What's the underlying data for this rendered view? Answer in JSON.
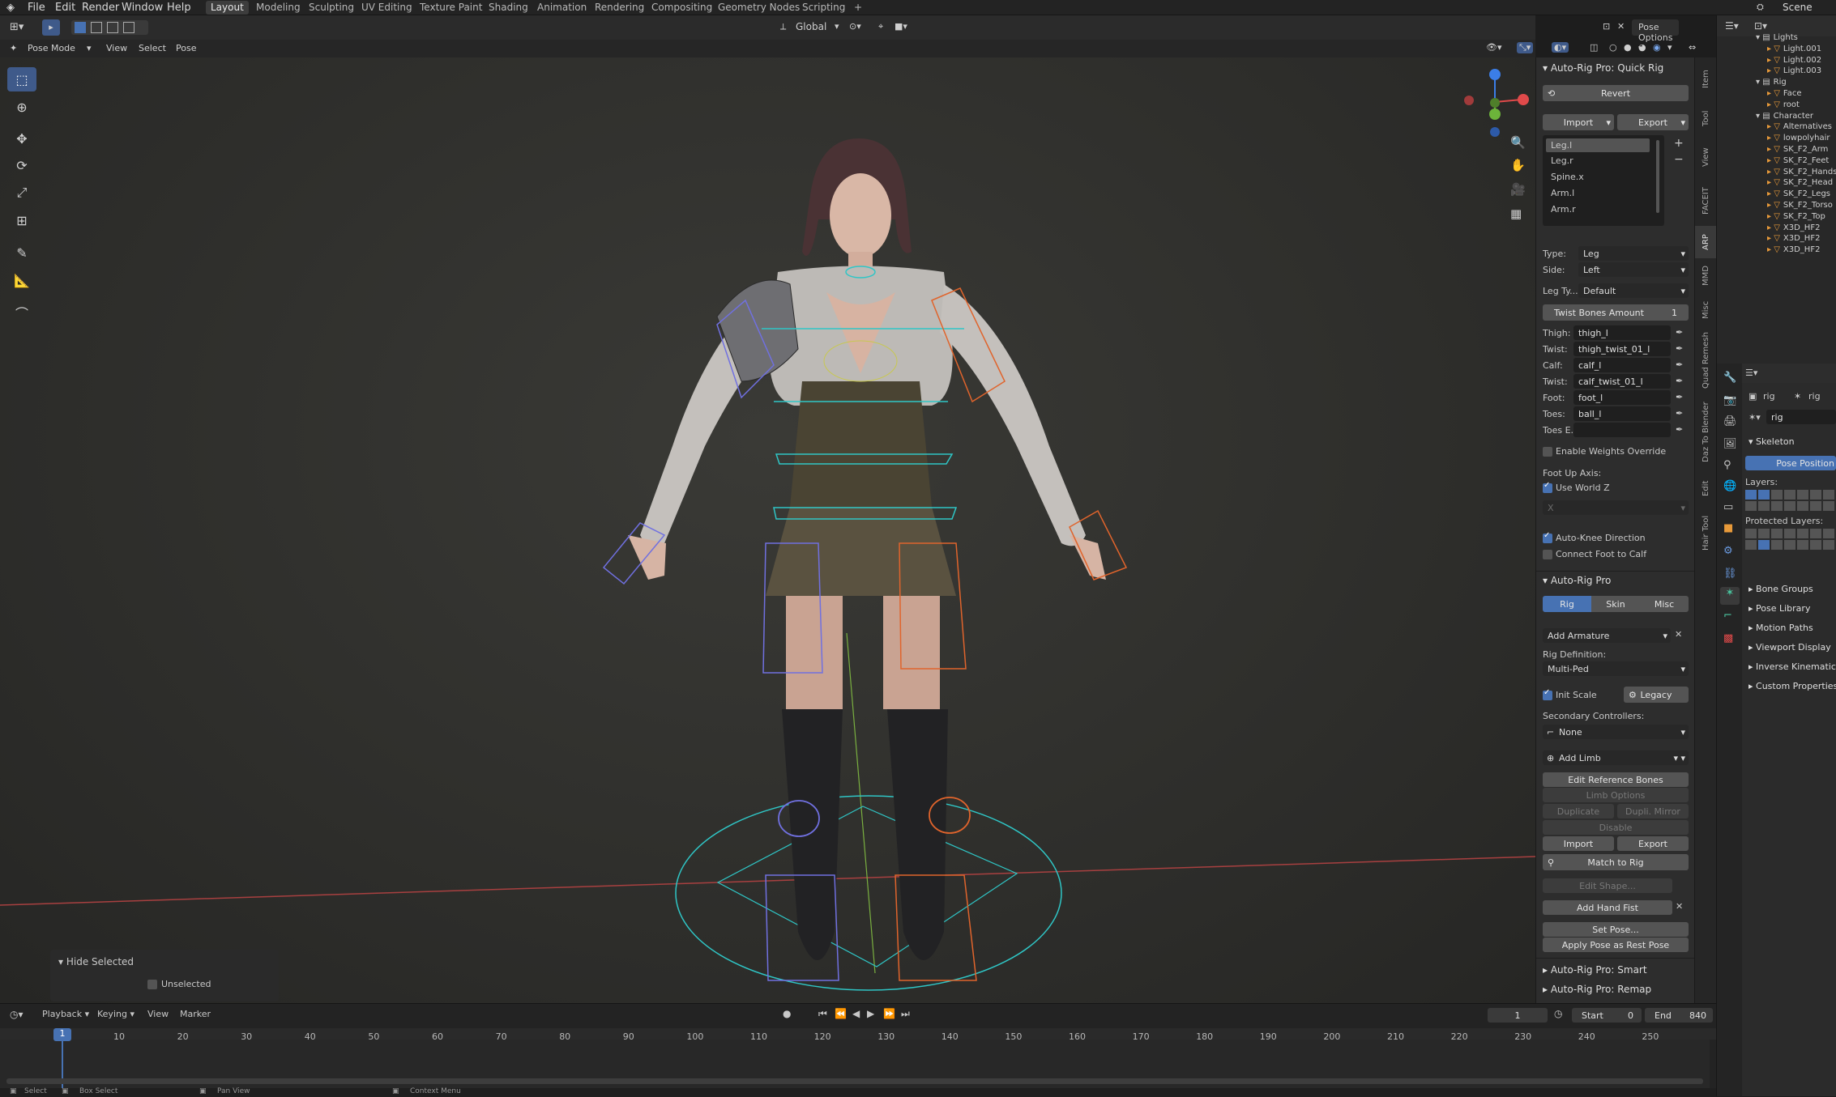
{
  "topbar": {
    "menus": [
      "File",
      "Edit",
      "Render",
      "Window",
      "Help"
    ],
    "workspaces": [
      "Layout",
      "Modeling",
      "Sculpting",
      "UV Editing",
      "Texture Paint",
      "Shading",
      "Animation",
      "Rendering",
      "Compositing",
      "Geometry Nodes",
      "Scripting"
    ],
    "add_tab": "+",
    "scene": "Scene"
  },
  "viewport_header": {
    "transform_space": "Global",
    "pose_options": "Pose Options",
    "mode": "Pose Mode",
    "menus": [
      "View",
      "Select",
      "Pose"
    ]
  },
  "overlay": {
    "hide_selected": "Hide Selected",
    "unselected": "Unselected"
  },
  "npanel": {
    "quickrig": {
      "title": "Auto-Rig Pro: Quick Rig",
      "revert": "Revert",
      "import": "Import",
      "export": "Export",
      "list": [
        "Leg.l",
        "Leg.r",
        "Spine.x",
        "Arm.l",
        "Arm.r"
      ],
      "type_label": "Type:",
      "type_value": "Leg",
      "side_label": "Side:",
      "side_value": "Left",
      "legtype_label": "Leg Ty...",
      "legtype_value": "Default",
      "twist_amount_label": "Twist Bones Amount",
      "twist_amount_value": "1",
      "bones": [
        {
          "label": "Thigh:",
          "value": "thigh_l"
        },
        {
          "label": "Twist:",
          "value": "thigh_twist_01_l"
        },
        {
          "label": "Calf:",
          "value": "calf_l"
        },
        {
          "label": "Twist:",
          "value": "calf_twist_01_l"
        },
        {
          "label": "Foot:",
          "value": "foot_l"
        },
        {
          "label": "Toes:",
          "value": "ball_l"
        },
        {
          "label": "Toes E...",
          "value": ""
        }
      ],
      "enable_weights": "Enable Weights Override",
      "foot_up_axis": "Foot Up Axis:",
      "use_world_z": "Use World Z",
      "axis_value": "X",
      "auto_knee": "Auto-Knee Direction",
      "connect_foot": "Connect Foot to Calf"
    },
    "arp": {
      "title": "Auto-Rig Pro",
      "tabs": [
        "Rig",
        "Skin",
        "Misc"
      ],
      "add_armature": "Add Armature",
      "rig_definition_label": "Rig Definition:",
      "rig_definition_value": "Multi-Ped",
      "init_scale": "Init Scale",
      "legacy": "Legacy",
      "secondary_label": "Secondary Controllers:",
      "secondary_value": "None",
      "add_limb": "Add Limb",
      "edit_ref": "Edit Reference Bones",
      "limb_options": "Limb Options",
      "duplicate": "Duplicate",
      "dupli_mirror": "Dupli. Mirror",
      "disable": "Disable",
      "import": "Import",
      "export": "Export",
      "match_to_rig": "Match to Rig",
      "edit_shape": "Edit Shape...",
      "add_hand_fist": "Add Hand Fist",
      "set_pose": "Set Pose...",
      "apply_pose": "Apply Pose as Rest Pose"
    },
    "collapsed": [
      "Auto-Rig Pro: Smart",
      "Auto-Rig Pro: Remap"
    ]
  },
  "side_tabs": [
    "Item",
    "Tool",
    "View",
    "FACEIT",
    "ARP",
    "MMD",
    "Misc",
    "Quad Remesh",
    "Daz To Blender",
    "Edit",
    "Hair Tool"
  ],
  "outliner": {
    "rows": [
      {
        "name": "Lights",
        "indent": 1
      },
      {
        "name": "Light.001",
        "indent": 2
      },
      {
        "name": "Light.002",
        "indent": 2
      },
      {
        "name": "Light.003",
        "indent": 2
      },
      {
        "name": "Rig",
        "indent": 1
      },
      {
        "name": "Face",
        "indent": 2
      },
      {
        "name": "root",
        "indent": 2
      },
      {
        "name": "Character",
        "indent": 1
      },
      {
        "name": "Alternatives",
        "indent": 2
      },
      {
        "name": "lowpolyhair",
        "indent": 2
      },
      {
        "name": "SK_F2_Arm",
        "indent": 2
      },
      {
        "name": "SK_F2_Feet",
        "indent": 2
      },
      {
        "name": "SK_F2_Hands",
        "indent": 2
      },
      {
        "name": "SK_F2_Head",
        "indent": 2
      },
      {
        "name": "SK_F2_Legs",
        "indent": 2
      },
      {
        "name": "SK_F2_Torso",
        "indent": 2
      },
      {
        "name": "SK_F2_Top",
        "indent": 2
      },
      {
        "name": "X3D_HF2",
        "indent": 2
      },
      {
        "name": "X3D_HF2",
        "indent": 2
      },
      {
        "name": "X3D_HF2",
        "indent": 2
      }
    ]
  },
  "properties": {
    "object": "rig",
    "data": "rig",
    "data_field": "rig",
    "skeleton": "Skeleton",
    "pose_position": "Pose Position",
    "layers": "Layers:",
    "protected_layers": "Protected Layers:",
    "sections": [
      "Bone Groups",
      "Pose Library",
      "Motion Paths",
      "Viewport Display",
      "Inverse Kinematics",
      "Custom Properties"
    ]
  },
  "timeline": {
    "menus": [
      "Playback",
      "Keying",
      "View",
      "Marker"
    ],
    "current_frame": "1",
    "start_label": "Start",
    "start": "0",
    "end_label": "End",
    "end": "840",
    "ticks": [
      "10",
      "20",
      "30",
      "40",
      "50",
      "60",
      "70",
      "80",
      "90",
      "100",
      "110",
      "120",
      "130",
      "140",
      "150",
      "160",
      "170",
      "180",
      "190",
      "200",
      "210",
      "220",
      "230",
      "240",
      "250"
    ],
    "status": [
      "Select",
      "Box Select",
      "Pan View",
      "Context Menu"
    ]
  },
  "colors": {
    "accent": "#4772b3",
    "x_axis": "#e04a4a",
    "y_axis": "#6cb43a",
    "z_axis": "#3b7ee8",
    "rig_cyan": "#2fc6c6",
    "rig_orange": "#e0642c",
    "rig_blue": "#7070e0"
  }
}
